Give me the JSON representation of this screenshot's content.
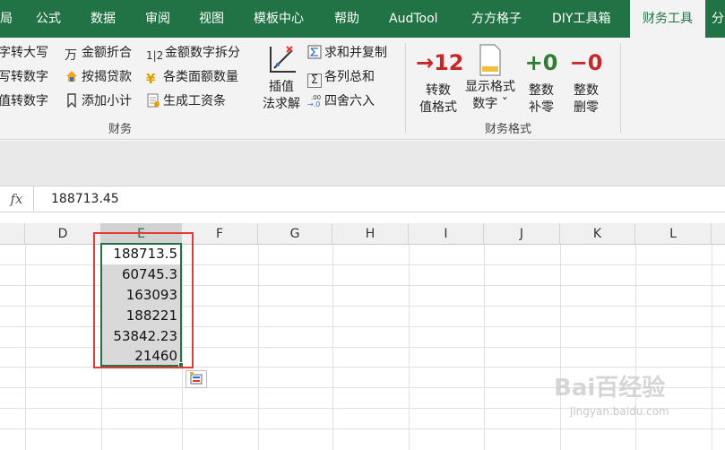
{
  "tabs": [
    {
      "label": "局",
      "active": false
    },
    {
      "label": "公式",
      "active": false
    },
    {
      "label": "数据",
      "active": false
    },
    {
      "label": "审阅",
      "active": false
    },
    {
      "label": "视图",
      "active": false
    },
    {
      "label": "模板中心",
      "active": false
    },
    {
      "label": "帮助",
      "active": false
    },
    {
      "label": "AudTool",
      "active": false
    },
    {
      "label": "方方格子",
      "active": false
    },
    {
      "label": "DIY工具箱",
      "active": false
    },
    {
      "label": "财务工具",
      "active": true
    },
    {
      "label": "分",
      "active": false
    }
  ],
  "ribbon": {
    "finance_group": {
      "label": "财务",
      "items": [
        {
          "label": "字转大写",
          "icon": "convert-icon"
        },
        {
          "label": "写转数字",
          "icon": "convert-icon"
        },
        {
          "label": "值转数字",
          "icon": "convert-icon"
        },
        {
          "label": "金额折合",
          "icon": "wan-icon",
          "glyph": "万"
        },
        {
          "label": "按揭贷款",
          "icon": "house-icon"
        },
        {
          "label": "添加小计",
          "icon": "bookmark-icon"
        },
        {
          "label": "金额数字拆分",
          "icon": "split-digits-icon",
          "glyph": "1|2"
        },
        {
          "label": "各类面额数量",
          "icon": "yen-icon",
          "glyph": "¥"
        },
        {
          "label": "生成工资条",
          "icon": "payslip-icon"
        },
        {
          "label": "求和并复制",
          "icon": "sum-copy-icon"
        },
        {
          "label": "各列总和",
          "icon": "sigma-icon",
          "glyph": "Σ"
        },
        {
          "label": "四舍六入",
          "icon": "round-icon"
        }
      ],
      "interp_label_1": "插值",
      "interp_label_2": "法求解"
    },
    "format_group": {
      "label": "财务格式",
      "buttons": [
        {
          "glyph": "→12",
          "line1": "转数",
          "line2": "值格式",
          "icon": "to-number-icon",
          "color": "#d32f2f"
        },
        {
          "glyph": "",
          "line1": "显示格式",
          "line2": "数字 ˇ",
          "icon": "document-icon",
          "color": "#f0c040"
        },
        {
          "glyph": "+0",
          "line1": "整数",
          "line2": "补零",
          "icon": "plus-zero-icon",
          "color": "#2e7d32"
        },
        {
          "glyph": "−0",
          "line1": "整数",
          "line2": "删零",
          "icon": "minus-zero-icon",
          "color": "#d32f2f"
        }
      ]
    }
  },
  "formula_bar": {
    "fx_label": "fx",
    "value": "188713.45"
  },
  "grid": {
    "columns": [
      "D",
      "E",
      "F",
      "G",
      "H",
      "I",
      "J",
      "K",
      "L"
    ],
    "selected_column": "E",
    "cells": [
      "188713.5",
      "60745.3",
      "163093",
      "188221",
      "53842.23",
      "21460"
    ]
  },
  "watermark": {
    "text": "Bai百经验",
    "sub": "jingyan.baidu.com"
  }
}
